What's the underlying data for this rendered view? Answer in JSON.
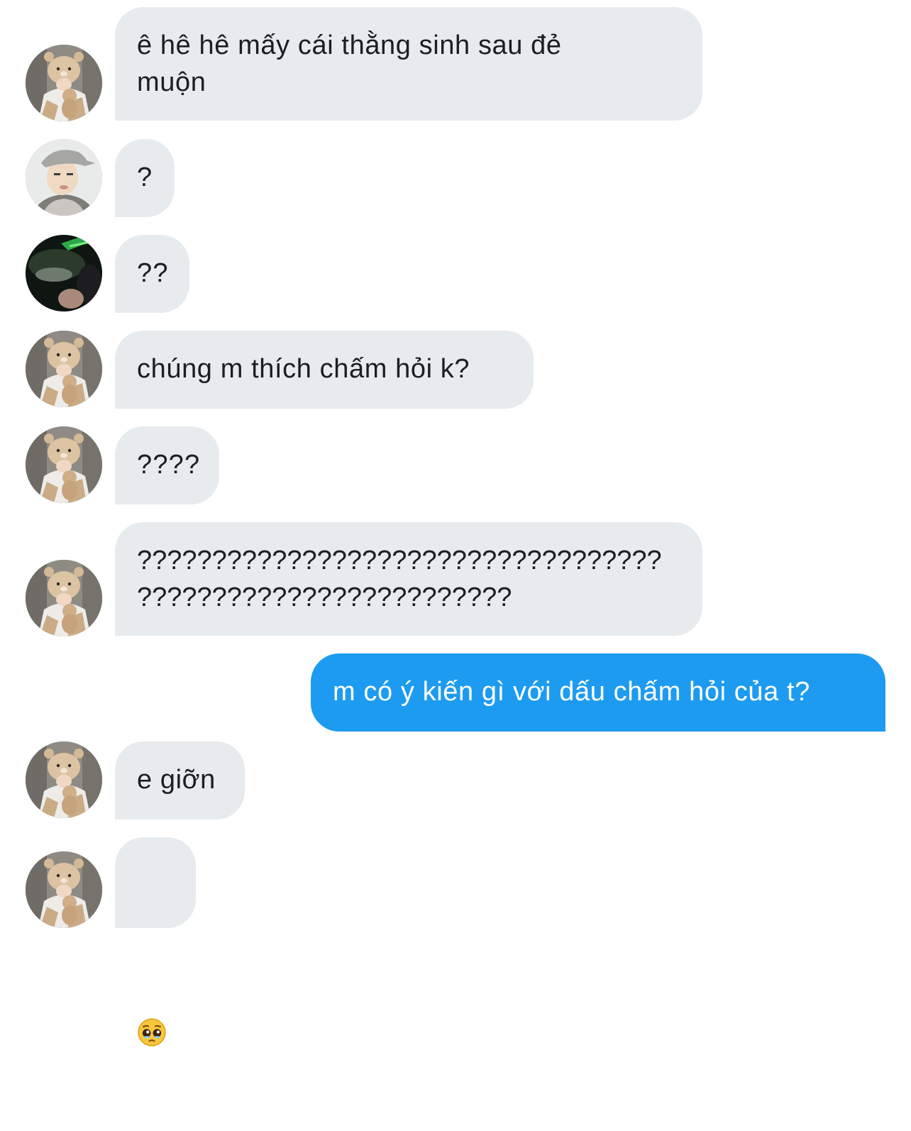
{
  "messages": [
    {
      "direction": "incoming",
      "avatar": "bear-hat-avatar",
      "text": "ê hê hê mấy cái thằng sinh sau đẻ\nmuộn"
    },
    {
      "direction": "incoming",
      "avatar": "gray-cap-avatar",
      "text": "?"
    },
    {
      "direction": "incoming",
      "avatar": "dark-green-avatar",
      "text": "??"
    },
    {
      "direction": "incoming",
      "avatar": "bear-hat-avatar",
      "text": "chúng m thích chấm hỏi k?"
    },
    {
      "direction": "incoming",
      "avatar": "bear-hat-avatar",
      "text": "????"
    },
    {
      "direction": "incoming",
      "avatar": "bear-hat-avatar",
      "text": "???????????????????????????????????\n?????????????????????????"
    },
    {
      "direction": "outgoing",
      "text": "m có ý kiến gì với dấu chấm hỏi của t?"
    },
    {
      "direction": "incoming",
      "avatar": "bear-hat-avatar",
      "text": "e giỡn"
    },
    {
      "direction": "incoming",
      "avatar": "bear-hat-avatar",
      "emoji": "pleading-face-emoji"
    }
  ],
  "colors": {
    "incoming_bubble": "#e7ebee",
    "outgoing_bubble": "#1d9bf0",
    "incoming_text": "#1c1e21",
    "outgoing_text": "#ffffff",
    "background": "#ffffff"
  }
}
